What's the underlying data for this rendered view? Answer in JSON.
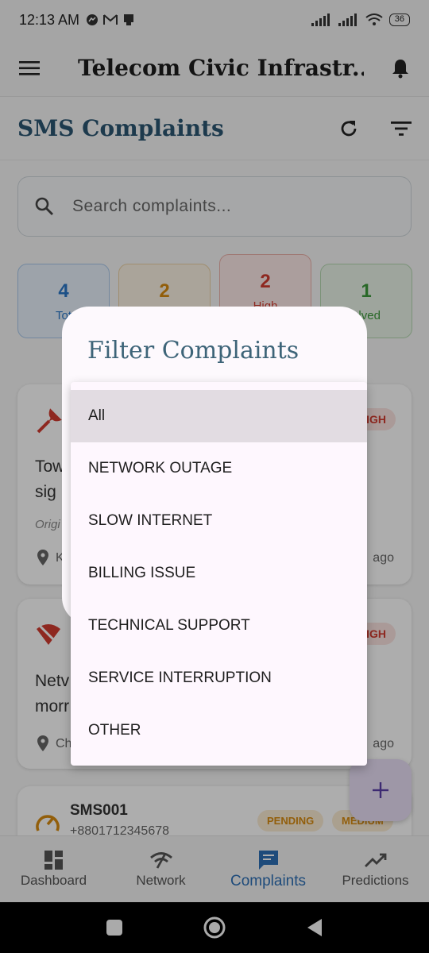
{
  "status_bar": {
    "time": "12:13 AM",
    "battery": "36"
  },
  "app_bar": {
    "title": "Telecom Civic Infrastr..."
  },
  "page": {
    "title": "SMS Complaints"
  },
  "search": {
    "placeholder": "Search complaints..."
  },
  "stats": [
    {
      "value": "4",
      "label": "Tot"
    },
    {
      "value": "2",
      "label": ""
    },
    {
      "value": "2",
      "label": "High"
    },
    {
      "value": "1",
      "label": "olved"
    }
  ],
  "cards": [
    {
      "badge": "IGH",
      "text_line1": "Tow",
      "text_line2": "sig",
      "meta": "Origi",
      "location": "K",
      "time": "ago"
    },
    {
      "badge": "IGH",
      "text_line1": "Netv",
      "text_line2": "morr",
      "location": "Ch",
      "time": "ago"
    },
    {
      "id": "SMS001",
      "phone": "+8801712345678",
      "status": "PENDING",
      "priority": "MEDIUM"
    }
  ],
  "dialog": {
    "title": "Filter Complaints",
    "options": [
      "All",
      "NETWORK OUTAGE",
      "SLOW INTERNET",
      "BILLING ISSUE",
      "TECHNICAL SUPPORT",
      "SERVICE INTERRUPTION",
      "OTHER"
    ],
    "selected": "All"
  },
  "bottom_nav": [
    {
      "label": "Dashboard",
      "icon": "dashboard-icon"
    },
    {
      "label": "Network",
      "icon": "network-icon"
    },
    {
      "label": "Complaints",
      "icon": "complaints-icon",
      "active": true
    },
    {
      "label": "Predictions",
      "icon": "trending-icon"
    }
  ],
  "colors": {
    "accent": "#2d6fb5",
    "title_blue": "#2c5672",
    "danger": "#d23b30",
    "warning": "#d88b10",
    "success": "#3d9a3c"
  }
}
